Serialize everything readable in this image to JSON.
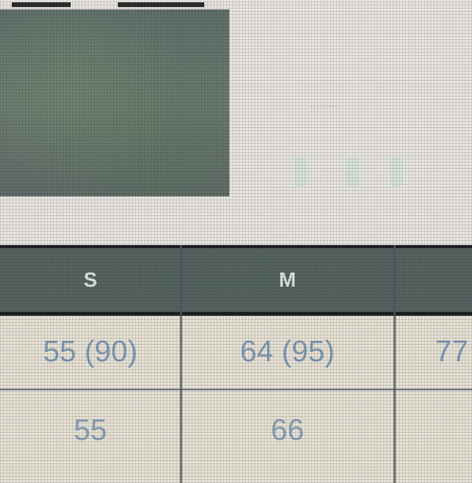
{
  "caption": "··· ·· ····",
  "size_table": {
    "headers": [
      "S",
      "M",
      ""
    ],
    "rows": [
      [
        "55 (90)",
        "64 (95)",
        "77"
      ],
      [
        "55",
        "66",
        ""
      ]
    ]
  },
  "colors": {
    "header_bg": "#55635f",
    "cell_text": "#7f9ab3",
    "row_bg": "#e8e2d4"
  }
}
